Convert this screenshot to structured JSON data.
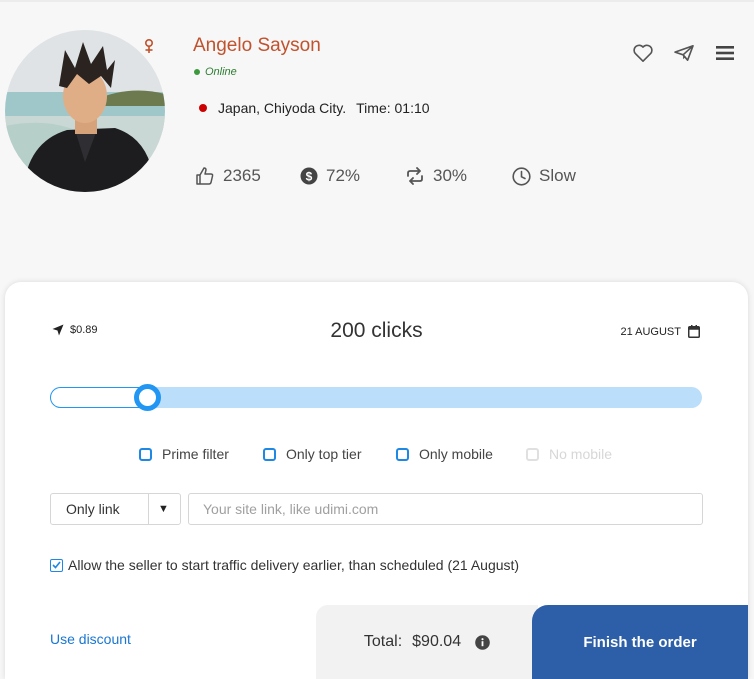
{
  "seller": {
    "name": "Angelo Sayson",
    "status": "Online",
    "location": "Japan, Chiyoda City.",
    "time": "Time: 01:10"
  },
  "stats": {
    "likes": "2365",
    "sales_percent": "72%",
    "repeat_percent": "30%",
    "speed": "Slow"
  },
  "order": {
    "price_per_click": "$0.89",
    "clicks": "200 clicks",
    "date": "21 AUGUST",
    "slider_fraction": 0.15,
    "filters": [
      {
        "label": "Prime filter",
        "checked": false,
        "disabled": false
      },
      {
        "label": "Only top tier",
        "checked": false,
        "disabled": false
      },
      {
        "label": "Only mobile",
        "checked": false,
        "disabled": false
      },
      {
        "label": "No mobile",
        "checked": false,
        "disabled": true
      }
    ],
    "link_type": "Only link",
    "site_placeholder": "Your site link, like udimi.com",
    "allow_early": "Allow the seller to start traffic delivery earlier, than scheduled (21 August)",
    "allow_early_checked": true,
    "discount_label": "Use discount",
    "total_label": "Total:",
    "total_amount": "$90.04",
    "finish_label": "Finish the order"
  },
  "colors": {
    "accent": "#2196f3",
    "name": "#c0522d",
    "online": "#3c9a3c",
    "finish_button": "#2d5ea8"
  },
  "icons": [
    "gender-icon",
    "heart-icon",
    "send-icon",
    "menu-icon",
    "thumbs-up-icon",
    "dollar-icon",
    "repeat-icon",
    "clock-icon",
    "location-arrow-icon",
    "calendar-icon",
    "info-icon",
    "check-icon"
  ]
}
